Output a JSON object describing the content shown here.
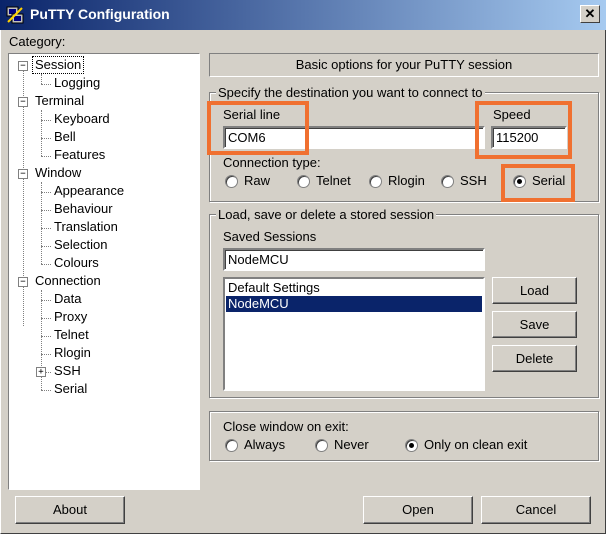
{
  "window": {
    "title": "PuTTY Configuration",
    "close_symbol": "✕",
    "app_icon": "putty-icon"
  },
  "category": {
    "label": "Category:",
    "tree": [
      {
        "label": "Session",
        "selected": true
      },
      {
        "label": "Logging"
      },
      {
        "label": "Terminal"
      },
      {
        "label": "Keyboard"
      },
      {
        "label": "Bell"
      },
      {
        "label": "Features"
      },
      {
        "label": "Window"
      },
      {
        "label": "Appearance"
      },
      {
        "label": "Behaviour"
      },
      {
        "label": "Translation"
      },
      {
        "label": "Selection"
      },
      {
        "label": "Colours"
      },
      {
        "label": "Connection"
      },
      {
        "label": "Data"
      },
      {
        "label": "Proxy"
      },
      {
        "label": "Telnet"
      },
      {
        "label": "Rlogin"
      },
      {
        "label": "SSH"
      },
      {
        "label": "Serial"
      }
    ],
    "expander_minus": "−",
    "expander_plus": "+"
  },
  "session": {
    "banner": "Basic options for your PuTTY session",
    "destination_group": "Specify the destination you want to connect to",
    "serial_line_label": "Serial line",
    "serial_line_value": "COM6",
    "speed_label": "Speed",
    "speed_value": "115200",
    "connection_type_label": "Connection type:",
    "connection_types": [
      "Raw",
      "Telnet",
      "Rlogin",
      "SSH",
      "Serial"
    ],
    "connection_type_selected": "Serial",
    "stored_group": "Load, save or delete a stored session",
    "saved_sessions_label": "Saved Sessions",
    "saved_sessions_value": "NodeMCU",
    "sessions_list": [
      "Default Settings",
      "NodeMCU"
    ],
    "sessions_selected": "NodeMCU",
    "load_button": "Load",
    "save_button": "Save",
    "delete_button": "Delete",
    "close_group": "Close window on exit:",
    "close_options": [
      "Always",
      "Never",
      "Only on clean exit"
    ],
    "close_selected": "Only on clean exit"
  },
  "footer": {
    "about_button": "About",
    "open_button": "Open",
    "cancel_button": "Cancel"
  },
  "colors": {
    "highlight": "#f07030",
    "title_bar": "#0a246a",
    "selection": "#0a246a"
  }
}
